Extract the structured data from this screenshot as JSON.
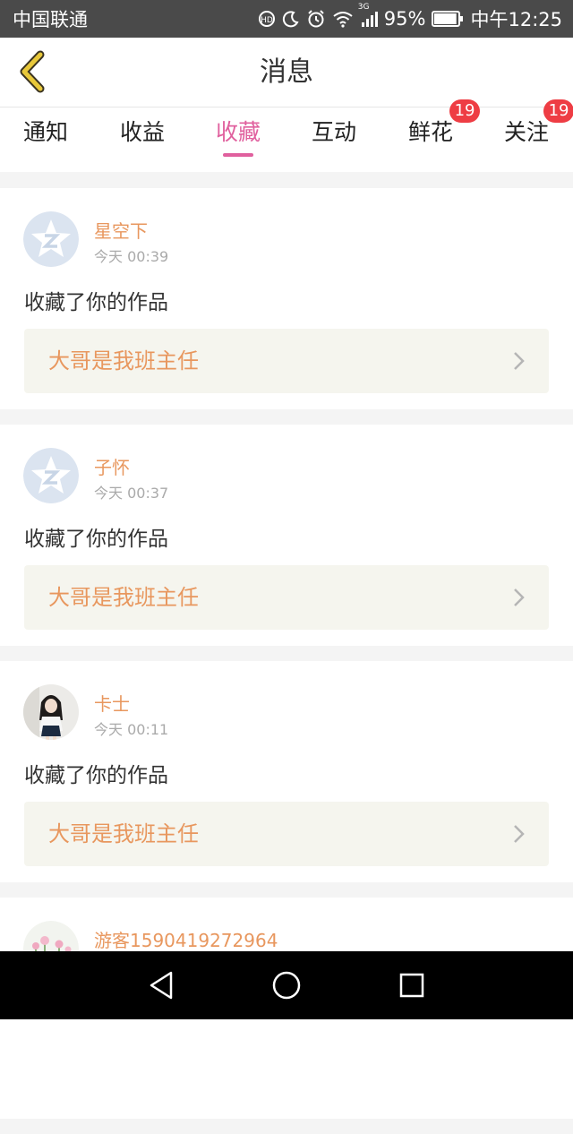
{
  "status_bar": {
    "carrier": "中国联通",
    "network": "3G",
    "battery": "95%",
    "battery_level": 0.95,
    "time": "中午12:25",
    "icons": [
      "hd-icon",
      "moon-icon",
      "alarm-icon",
      "wifi-icon",
      "signal-icon",
      "battery-icon"
    ]
  },
  "header": {
    "back_icon": "chevron-left-icon",
    "title": "消息"
  },
  "tabs": [
    {
      "label": "通知",
      "active": false,
      "badge": ""
    },
    {
      "label": "收益",
      "active": false,
      "badge": ""
    },
    {
      "label": "收藏",
      "active": true,
      "badge": ""
    },
    {
      "label": "互动",
      "active": false,
      "badge": ""
    },
    {
      "label": "鲜花",
      "active": false,
      "badge": "19"
    },
    {
      "label": "关注",
      "active": false,
      "badge": "19"
    }
  ],
  "feed": [
    {
      "user": "星空下",
      "time": "今天 00:39",
      "action": "收藏了你的作品",
      "work": "大哥是我班主任",
      "avatar": "default-star-avatar"
    },
    {
      "user": "子怀",
      "time": "今天 00:37",
      "action": "收藏了你的作品",
      "work": "大哥是我班主任",
      "avatar": "default-star-avatar"
    },
    {
      "user": "卡士",
      "time": "今天 00:11",
      "action": "收藏了你的作品",
      "work": "大哥是我班主任",
      "avatar": "photo-girl-avatar"
    },
    {
      "user": "游客1590419272964",
      "time": "",
      "action": "",
      "work": "",
      "avatar": "flower-avatar"
    }
  ],
  "colors": {
    "accent": "#e0609e",
    "name_orange": "#e8975e",
    "badge_red": "#ee3d44",
    "back_yellow": "#e8c83a"
  },
  "nav_bar": {
    "icons": [
      "back-triangle-icon",
      "home-circle-icon",
      "recents-square-icon"
    ]
  }
}
